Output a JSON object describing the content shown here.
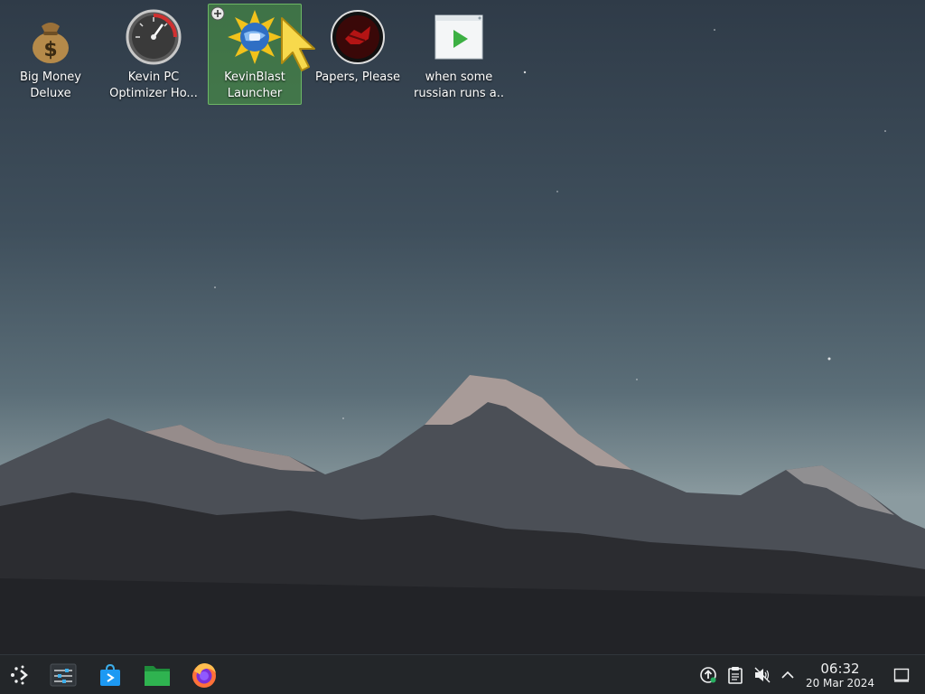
{
  "desktop": {
    "icons": [
      {
        "line1": "Big Money",
        "line2": "Deluxe",
        "icon": "money-bag-icon"
      },
      {
        "line1": "Kevin PC",
        "line2": "Optimizer Ho...",
        "icon": "speedometer-icon"
      },
      {
        "line1": "KevinBlast",
        "line2": "Launcher",
        "icon": "kevinblast-icon",
        "selected": true
      },
      {
        "line1": "Papers, Please",
        "line2": "",
        "icon": "papers-please-icon"
      },
      {
        "line1": "when some",
        "line2": "russian runs a...",
        "icon": "video-file-icon"
      }
    ]
  },
  "taskbar": {
    "apps": [
      {
        "name": "application-launcher",
        "icon": "kde-launcher-icon"
      },
      {
        "name": "system-settings",
        "icon": "settings-sliders-icon"
      },
      {
        "name": "discover-store",
        "icon": "store-bag-icon"
      },
      {
        "name": "file-manager",
        "icon": "folder-icon"
      },
      {
        "name": "firefox",
        "icon": "firefox-icon"
      }
    ],
    "tray": [
      {
        "name": "updates",
        "icon": "update-arrow-icon"
      },
      {
        "name": "clipboard",
        "icon": "clipboard-icon"
      },
      {
        "name": "volume",
        "icon": "volume-muted-icon"
      },
      {
        "name": "show-hidden",
        "icon": "chevron-up-icon"
      }
    ],
    "clock": {
      "time": "06:32",
      "date": "20 Mar 2024"
    }
  },
  "colors": {
    "taskbar_bg": "#232629",
    "selection": "#4ca046",
    "text": "#ffffff"
  }
}
